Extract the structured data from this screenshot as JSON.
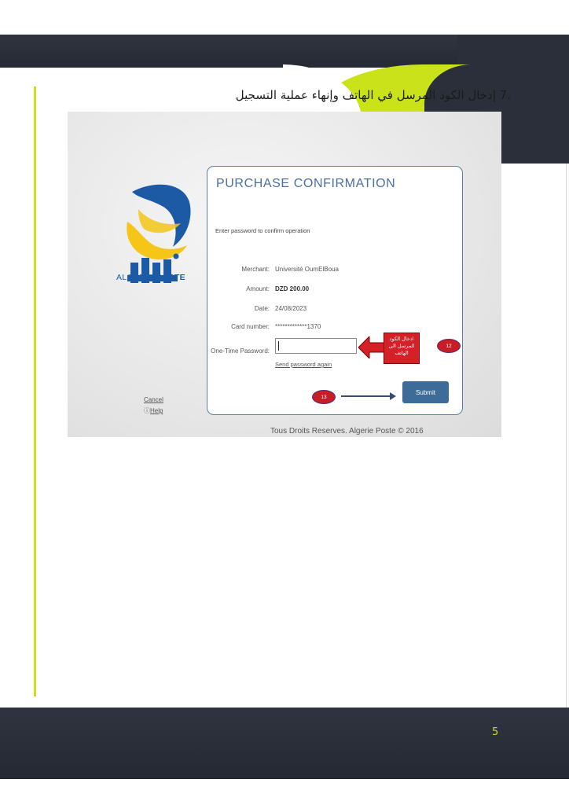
{
  "document": {
    "step_title": ".7 إدخال الكود المرسل في الهاتف وإنهاء عملية التسجيل",
    "page_number": "5"
  },
  "colors": {
    "accent": "#c9e21a",
    "band_dark": "#2b2f3a",
    "card_blue": "#4a6fa1",
    "submit_blue": "#3d6c98",
    "annotation_red": "#d42027"
  },
  "logo": {
    "brand_left": "ALGÉRIE ",
    "brand_right": "POSTE"
  },
  "purchase": {
    "title": "PURCHASE CONFIRMATION",
    "subtitle": "Enter password to confirm operation",
    "fields": [
      {
        "label": "Merchant:",
        "value": "Université OumElBoua",
        "bold": false
      },
      {
        "label": "Amount:",
        "value": "DZD 200.00",
        "bold": true
      },
      {
        "label": "Date:",
        "value": "24/08/2023",
        "bold": false
      },
      {
        "label": "Card number:",
        "value": "*************1370",
        "bold": false
      }
    ],
    "otp_label": "One-Time Password:",
    "otp_value": "",
    "send_again": "Send password again",
    "submit_label": "Submit",
    "cancel_label": "Cancel",
    "help_label": "Help",
    "copyright": "Tous Droits Reserves. Algerie Poste © 2016"
  },
  "annotations": {
    "otp_note": "ادخال الكود المرسل الى الهاتف",
    "badge_otp": "12",
    "badge_submit": "13"
  }
}
